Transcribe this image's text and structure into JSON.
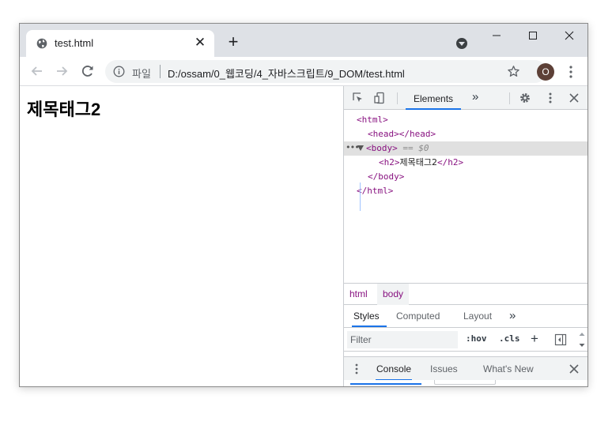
{
  "browser": {
    "tab": {
      "title": "test.html",
      "close_symbol": "✕"
    },
    "new_tab_symbol": "+",
    "address": {
      "scheme_label": "파일",
      "url": "D:/ossam/0_웹코딩/4_자바스크립트/9_DOM/test.html"
    },
    "profile_initial": "O"
  },
  "page": {
    "heading": "제목태그2"
  },
  "devtools": {
    "main_tabs": {
      "active": "Elements",
      "overflow": "»"
    },
    "dom_tree": {
      "line1": "<html>",
      "line2": "<head></head>",
      "line3_dots": "•••",
      "line3_tag": "<body>",
      "line3_ref": "== $0",
      "line4_open": "<h2>",
      "line4_text": "제목태그2",
      "line4_close": "</h2>",
      "line5": "</body>",
      "line6": "</html>"
    },
    "breadcrumbs": [
      "html",
      "body"
    ],
    "style_tabs": {
      "styles": "Styles",
      "computed": "Computed",
      "layout": "Layout",
      "overflow": "»"
    },
    "filter": {
      "placeholder": "Filter",
      "hov": ":hov",
      "cls": ".cls",
      "add": "+"
    },
    "drawer_tabs": {
      "console": "Console",
      "issues": "Issues",
      "whats_new": "What's New"
    }
  }
}
